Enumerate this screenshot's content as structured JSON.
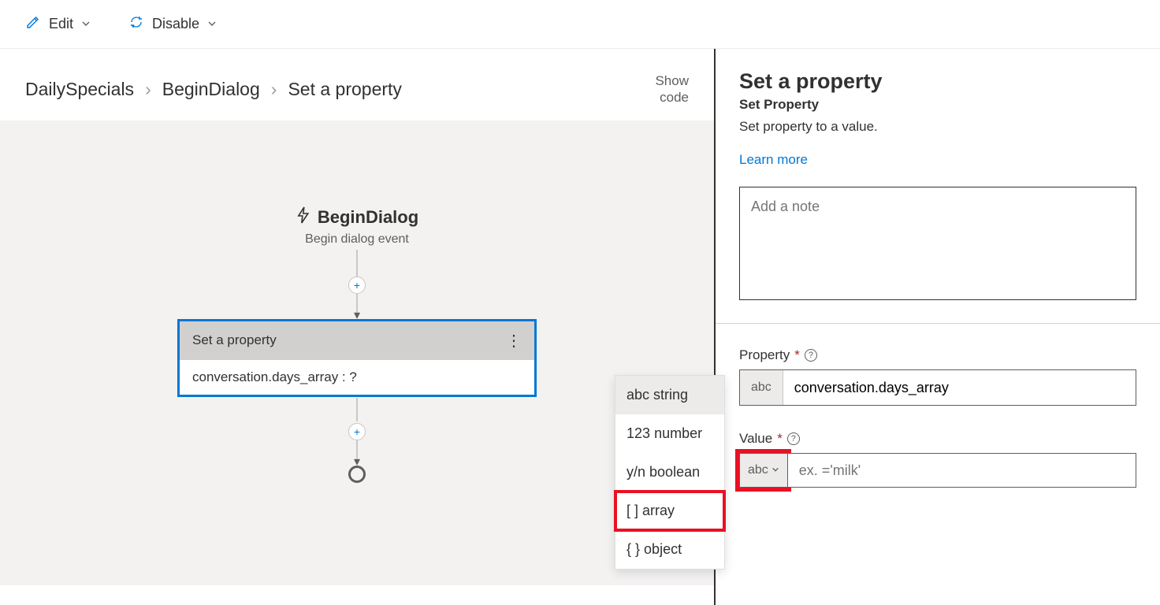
{
  "toolbar": {
    "edit_label": "Edit",
    "disable_label": "Disable"
  },
  "breadcrumb": {
    "items": [
      "DailySpecials",
      "BeginDialog",
      "Set a property"
    ]
  },
  "show_code": {
    "line1": "Show",
    "line2": "code"
  },
  "flow": {
    "begin_title": "BeginDialog",
    "begin_subtitle": "Begin dialog event",
    "node_title": "Set a property",
    "node_body": "conversation.days_array : ?"
  },
  "type_menu": {
    "items": [
      {
        "prefix": "abc",
        "label": "string",
        "selected": true,
        "highlighted": false
      },
      {
        "prefix": "123",
        "label": "number",
        "selected": false,
        "highlighted": false
      },
      {
        "prefix": "y/n",
        "label": "boolean",
        "selected": false,
        "highlighted": false
      },
      {
        "prefix": "[ ]",
        "label": "array",
        "selected": false,
        "highlighted": true
      },
      {
        "prefix": "{ }",
        "label": "object",
        "selected": false,
        "highlighted": false
      }
    ]
  },
  "panel": {
    "title": "Set a property",
    "subtitle": "Set Property",
    "description": "Set property to a value.",
    "learn_more": "Learn more",
    "note_placeholder": "Add a note",
    "property": {
      "label": "Property",
      "prefix": "abc",
      "value": "conversation.days_array"
    },
    "value": {
      "label": "Value",
      "prefix": "abc",
      "placeholder": "ex. ='milk'"
    }
  }
}
